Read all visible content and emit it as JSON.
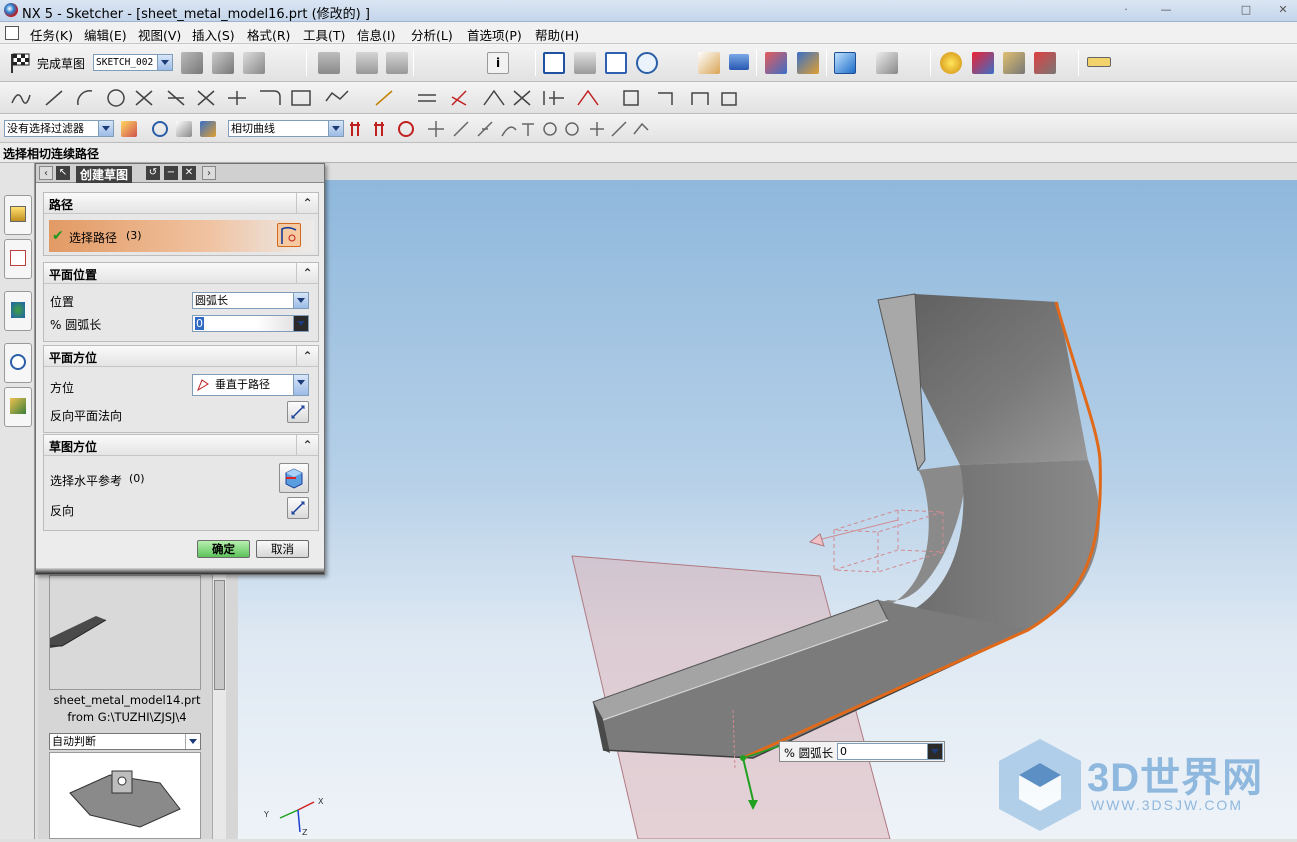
{
  "window": {
    "title": "NX 5 - Sketcher - [sheet_metal_model16.prt (修改的) ]"
  },
  "menu": [
    "任务(K)",
    "编辑(E)",
    "视图(V)",
    "插入(S)",
    "格式(R)",
    "工具(T)",
    "信息(I)",
    "分析(L)",
    "首选项(P)",
    "帮助(H)"
  ],
  "toolbar1": {
    "finish_sketch": "完成草图",
    "sketch_name": "SKETCH_002"
  },
  "toolbar3": {
    "filter": "没有选择过滤器",
    "curve_rule": "相切曲线"
  },
  "cue_line": "选择相切连续路径",
  "dialog": {
    "title": "创建草图",
    "path_section": {
      "title": "路径",
      "select_path": "选择路径",
      "count": "(3)"
    },
    "plane_position": {
      "title": "平面位置",
      "position_label": "位置",
      "position_value": "圆弧长",
      "arc_label": "% 圆弧长",
      "arc_value": "0"
    },
    "plane_orientation": {
      "title": "平面方位",
      "orientation_label": "方位",
      "orientation_value": "垂直于路径",
      "reverse_normal": "反向平面法向"
    },
    "sketch_orientation": {
      "title": "草图方位",
      "select_horizontal": "选择水平参考",
      "count": "(0)",
      "reverse": "反向"
    },
    "ok": "确定",
    "cancel": "取消"
  },
  "nav": {
    "file_line1": "sheet_metal_model14.prt",
    "file_line2": "from G:\\TUZHI\\ZJSJ\\4",
    "auto": "自动判断"
  },
  "viewport_tip": {
    "label": "% 圆弧长",
    "value": "0"
  },
  "axes": {
    "x": "X",
    "y": "Y",
    "z": "Z"
  },
  "watermark": {
    "brand": "3D世界网",
    "url": "WWW.3DSJW.COM"
  },
  "colors": {
    "accent_path": "#e06a1a",
    "selection_bar": "#e8a675",
    "viewport_top": "#8fb8dc"
  }
}
